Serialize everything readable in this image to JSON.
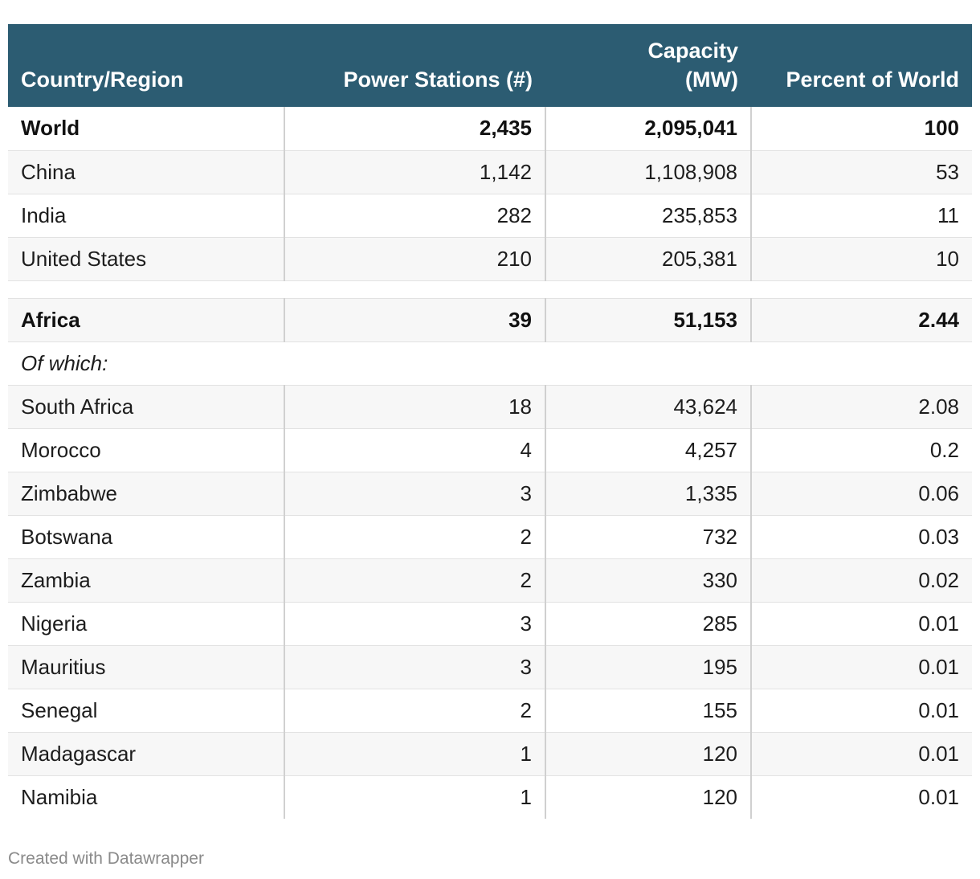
{
  "headers": {
    "country": "Country/Region",
    "stations": "Power Stations (#)",
    "capacity_line1": "Capacity",
    "capacity_line2": "(MW)",
    "percent": "Percent of World"
  },
  "rows": {
    "world": {
      "name": "World",
      "stations": "2,435",
      "capacity": "2,095,041",
      "percent": "100"
    },
    "china": {
      "name": "China",
      "stations": "1,142",
      "capacity": "1,108,908",
      "percent": "53"
    },
    "india": {
      "name": "India",
      "stations": "282",
      "capacity": "235,853",
      "percent": "11"
    },
    "united_states": {
      "name": "United States",
      "stations": "210",
      "capacity": "205,381",
      "percent": "10"
    },
    "africa": {
      "name": "Africa",
      "stations": "39",
      "capacity": "51,153",
      "percent": "2.44"
    },
    "of_which": {
      "name": "Of which:"
    },
    "south_africa": {
      "name": "South Africa",
      "stations": "18",
      "capacity": "43,624",
      "percent": "2.08"
    },
    "morocco": {
      "name": "Morocco",
      "stations": "4",
      "capacity": "4,257",
      "percent": "0.2"
    },
    "zimbabwe": {
      "name": "Zimbabwe",
      "stations": "3",
      "capacity": "1,335",
      "percent": "0.06"
    },
    "botswana": {
      "name": "Botswana",
      "stations": "2",
      "capacity": "732",
      "percent": "0.03"
    },
    "zambia": {
      "name": "Zambia",
      "stations": "2",
      "capacity": "330",
      "percent": "0.02"
    },
    "nigeria": {
      "name": "Nigeria",
      "stations": "3",
      "capacity": "285",
      "percent": "0.01"
    },
    "mauritius": {
      "name": "Mauritius",
      "stations": "3",
      "capacity": "195",
      "percent": "0.01"
    },
    "senegal": {
      "name": "Senegal",
      "stations": "2",
      "capacity": "155",
      "percent": "0.01"
    },
    "madagascar": {
      "name": "Madagascar",
      "stations": "1",
      "capacity": "120",
      "percent": "0.01"
    },
    "namibia": {
      "name": "Namibia",
      "stations": "1",
      "capacity": "120",
      "percent": "0.01"
    }
  },
  "footer": "Created with Datawrapper",
  "colors": {
    "header_bg": "#2c5c72",
    "header_text": "#ffffff",
    "row_shade": "#f7f7f7",
    "footer_text": "#8a8a8a"
  }
}
